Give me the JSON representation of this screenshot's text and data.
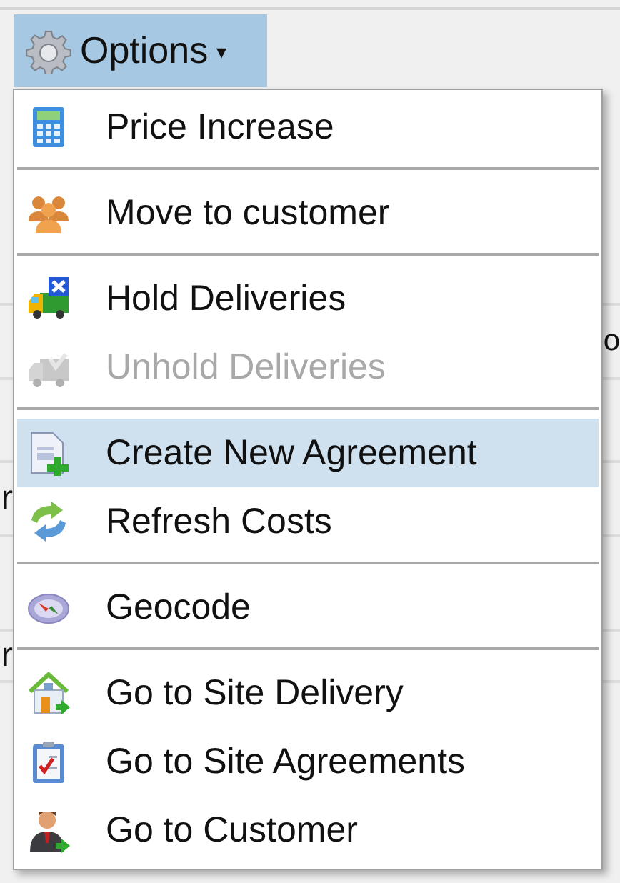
{
  "toolbar": {
    "options_button": {
      "label": "Options",
      "caret": "▾",
      "selected": true
    }
  },
  "grid": {
    "rows": [
      {
        "column_2": "o"
      },
      {
        "column_1": "r"
      },
      {
        "column_1": "r"
      }
    ]
  },
  "menu": {
    "groups": [
      [
        {
          "label": "Price Increase",
          "disabled": false,
          "selected": false
        }
      ],
      [
        {
          "label": "Move to customer",
          "disabled": false,
          "selected": false
        }
      ],
      [
        {
          "label": "Hold Deliveries",
          "disabled": false,
          "selected": false
        },
        {
          "label": "Unhold Deliveries",
          "disabled": true,
          "selected": false
        }
      ],
      [
        {
          "label": "Create New Agreement",
          "disabled": false,
          "selected": true
        },
        {
          "label": "Refresh Costs",
          "disabled": false,
          "selected": false
        }
      ],
      [
        {
          "label": "Geocode",
          "disabled": false,
          "selected": false
        }
      ],
      [
        {
          "label": "Go to Site Delivery",
          "disabled": false,
          "selected": false
        },
        {
          "label": "Go to Site Agreements",
          "disabled": false,
          "selected": false
        },
        {
          "label": "Go to Customer",
          "disabled": false,
          "selected": false
        }
      ]
    ]
  }
}
